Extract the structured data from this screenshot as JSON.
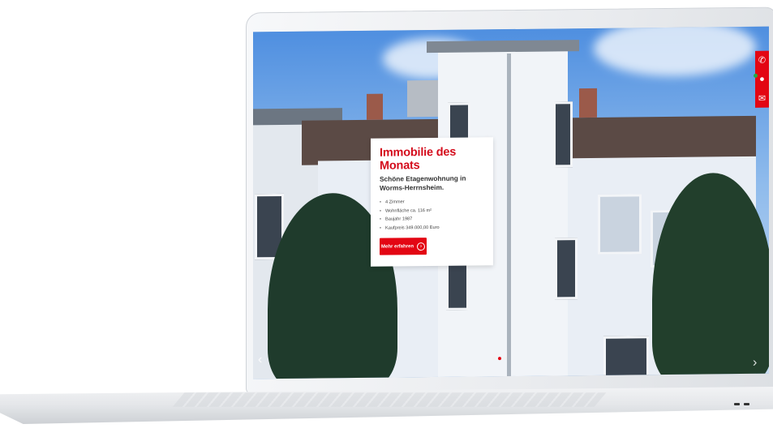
{
  "hero": {
    "title": "Immobilie des Monats",
    "subtitle": "Schöne Etagenwohnung in Worms-Herrnsheim.",
    "features": [
      "4 Zimmer",
      "Wohnfläche ca. 116 m²",
      "Baujahr 1987",
      "Kaufpreis 349.000,00 Euro"
    ],
    "cta_label": "Mehr erfahren",
    "cta_icon": "chevron-right-circle-icon"
  },
  "slider": {
    "slides": 3,
    "active_index": 1
  },
  "contact_bar": {
    "icons": [
      "phone-icon",
      "whatsapp-icon",
      "mail-icon"
    ],
    "color": "#e30613"
  },
  "colors": {
    "accent": "#e30613",
    "title": "#d40c1c"
  }
}
